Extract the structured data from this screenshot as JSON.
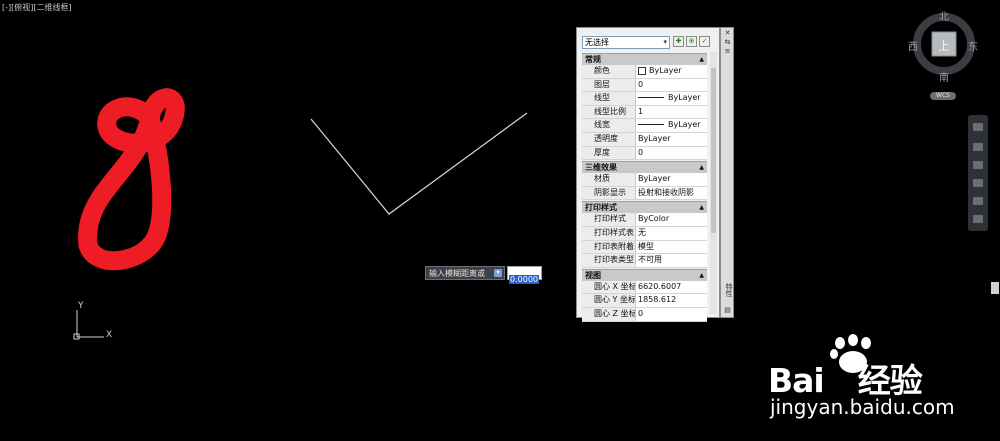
{
  "viewport": {
    "label": "[-][俯视][二维线框]"
  },
  "ucs": {
    "x_label": "X",
    "y_label": "Y"
  },
  "viewcube": {
    "north": "北",
    "south": "南",
    "east": "东",
    "west": "西",
    "face": "上",
    "wcs_label": "WCS"
  },
  "dynamic_input": {
    "prompt": "输入模糊距离或",
    "value": "0.0000"
  },
  "properties": {
    "selection": "无选择",
    "side_title": "特性",
    "categories": [
      {
        "name": "常规",
        "rows": [
          {
            "key": "颜色",
            "value": "ByLayer"
          },
          {
            "key": "图层",
            "value": "0"
          },
          {
            "key": "线型",
            "value": "ByLayer"
          },
          {
            "key": "线型比例",
            "value": "1"
          },
          {
            "key": "线宽",
            "value": "ByLayer"
          },
          {
            "key": "透明度",
            "value": "ByLayer"
          },
          {
            "key": "厚度",
            "value": "0"
          }
        ]
      },
      {
        "name": "三维效果",
        "rows": [
          {
            "key": "材质",
            "value": "ByLayer"
          },
          {
            "key": "阴影显示",
            "value": "投射和接收阴影"
          }
        ]
      },
      {
        "name": "打印样式",
        "rows": [
          {
            "key": "打印样式",
            "value": "ByColor"
          },
          {
            "key": "打印样式表",
            "value": "无"
          },
          {
            "key": "打印表附着到",
            "value": "模型"
          },
          {
            "key": "打印表类型",
            "value": "不可用"
          }
        ]
      },
      {
        "name": "视图",
        "rows": [
          {
            "key": "圆心 X 坐标",
            "value": "6620.6007"
          },
          {
            "key": "圆心 Y 坐标",
            "value": "1858.612"
          },
          {
            "key": "圆心 Z 坐标",
            "value": "0"
          }
        ]
      }
    ]
  },
  "watermark": {
    "brand": "Bai",
    "brand2": "经验",
    "url": "jingyan.baidu.com"
  },
  "colors": {
    "sketch": "#ee1c24",
    "line": "#d8d8d8",
    "background": "#000000"
  }
}
